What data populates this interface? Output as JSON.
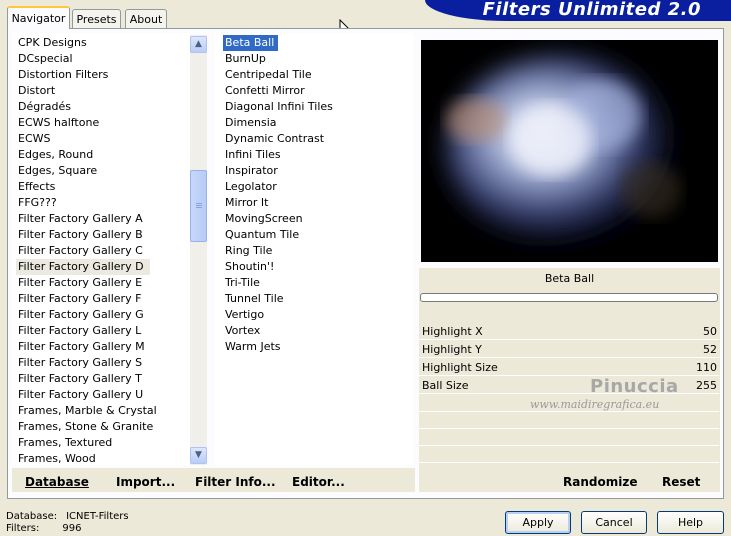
{
  "tabs": [
    {
      "label": "Navigator"
    },
    {
      "label": "Presets"
    },
    {
      "label": "About"
    }
  ],
  "banner": {
    "title": "Filters Unlimited 2.0"
  },
  "categories": [
    "CPK Designs",
    "DCspecial",
    "Distortion Filters",
    "Distort",
    "Dégradés",
    "ECWS halftone",
    "ECWS",
    "Edges, Round",
    "Edges, Square",
    "Effects",
    "FFG???",
    "Filter Factory Gallery A",
    "Filter Factory Gallery B",
    "Filter Factory Gallery C",
    "Filter Factory Gallery D",
    "Filter Factory Gallery E",
    "Filter Factory Gallery F",
    "Filter Factory Gallery G",
    "Filter Factory Gallery L",
    "Filter Factory Gallery M",
    "Filter Factory Gallery S",
    "Filter Factory Gallery T",
    "Filter Factory Gallery U",
    "Frames, Marble & Crystal",
    "Frames, Stone & Granite",
    "Frames, Textured",
    "Frames, Wood"
  ],
  "selected_category": "Filter Factory Gallery D",
  "filters": [
    "Beta Ball",
    "BurnUp",
    "Centripedal Tile",
    "Confetti Mirror",
    "Diagonal Infini Tiles",
    "Dimensia",
    "Dynamic Contrast",
    "Infini Tiles",
    "Inspirator",
    "Legolator",
    "Mirror It",
    "MovingScreen",
    "Quantum Tile",
    "Ring Tile",
    "Shoutin'!",
    "Tri-Tile",
    "Tunnel Tile",
    "Vertigo",
    "Vortex",
    "Warm Jets"
  ],
  "selected_filter": "Beta Ball",
  "left_buttons": [
    "Database",
    "Import...",
    "Filter Info...",
    "Editor..."
  ],
  "right_buttons": [
    "Randomize",
    "Reset"
  ],
  "filter_title": "Beta Ball",
  "progress": 0,
  "params": [
    {
      "label": "Highlight X",
      "value": "50"
    },
    {
      "label": "Highlight Y",
      "value": "52"
    },
    {
      "label": "Highlight Size",
      "value": "110"
    },
    {
      "label": "Ball Size",
      "value": "255"
    }
  ],
  "watermark": {
    "name": "Pinuccia",
    "url": "www.maidiregrafica.eu"
  },
  "status": {
    "database_label": "Database:",
    "database_value": "ICNET-Filters",
    "filters_label": "Filters:",
    "filters_value": "996"
  },
  "dialog_buttons": {
    "apply": "Apply",
    "cancel": "Cancel",
    "help": "Help"
  },
  "icons": {
    "scroll_up": "scroll-up-arrow",
    "scroll_down": "scroll-down-arrow",
    "cursor": "mouse-pointer"
  }
}
